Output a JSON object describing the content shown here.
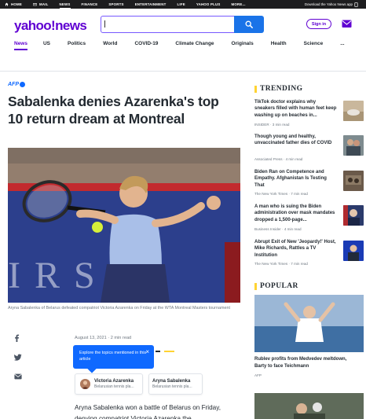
{
  "topbar": {
    "nav": [
      {
        "label": "HOME",
        "active": false
      },
      {
        "label": "MAIL",
        "active": false
      },
      {
        "label": "NEWS",
        "active": true
      },
      {
        "label": "FINANCE",
        "active": false
      },
      {
        "label": "SPORTS",
        "active": false
      },
      {
        "label": "ENTERTAINMENT",
        "active": false
      },
      {
        "label": "LIFE",
        "active": false
      },
      {
        "label": "YAHOO PLUS",
        "active": false
      },
      {
        "label": "MORE...",
        "active": false
      }
    ],
    "download_text": "Download the Yahoo News app"
  },
  "header": {
    "logo": "yahoo!news",
    "search": {
      "value": "",
      "placeholder": ""
    },
    "signin_label": "Sign in",
    "subnav": [
      {
        "label": "News",
        "active": true
      },
      {
        "label": "US",
        "active": false
      },
      {
        "label": "Politics",
        "active": false
      },
      {
        "label": "World",
        "active": false
      },
      {
        "label": "COVID-19",
        "active": false
      },
      {
        "label": "Climate Change",
        "active": false
      },
      {
        "label": "Originals",
        "active": false
      },
      {
        "label": "Health",
        "active": false
      },
      {
        "label": "Science",
        "active": false
      },
      {
        "label": "...",
        "active": false
      }
    ]
  },
  "article": {
    "source": "AFP",
    "headline": "Sabalenka denies Azarenka's top 10 return dream at Montreal",
    "caption": "Aryna Sabalenka of Belarus defeated compatriot Victoria Azarenka on Friday at the WTA Montreal Masters tournament",
    "date": "August 13, 2021",
    "read_time": "2 min read",
    "tooltip_text": "Explore the topics mentioned in this article",
    "tooltip_close": "×",
    "topics": [
      {
        "name": "Victoria Azarenka",
        "desc": "Belarusian tennis pla..."
      },
      {
        "name": "Aryna Sabalenka",
        "desc": "Belarusian tennis pla..."
      }
    ],
    "body_start": "Aryna Sabalenka won a battle of Belarus on Friday, denying compatriot Victoria Azarenka the"
  },
  "sidebar": {
    "trending_title": "TRENDING",
    "trending": [
      {
        "title": "TikTok doctor explains why sneakers filled with human feet keep washing up on beaches in...",
        "source": "INSIDER",
        "read_time": "3 min read"
      },
      {
        "title": "Though young and healthy, unvaccinated father dies of COVID",
        "source": "Associated Press",
        "read_time": "4 min read"
      },
      {
        "title": "Biden Ran on Competence and Empathy. Afghanistan Is Testing That",
        "source": "The New York Times",
        "read_time": "7 min read"
      },
      {
        "title": "A man who is suing the Biden administration over mask mandates dropped a 1,500-page...",
        "source": "Business Insider",
        "read_time": "4 min read"
      },
      {
        "title": "Abrupt Exit of New 'Jeopardy!' Host, Mike Richards, Rattles a TV Institution",
        "source": "The New York Times",
        "read_time": "7 min read"
      }
    ],
    "popular_title": "POPULAR",
    "popular": [
      {
        "title": "Rublev profits from Medvedev meltdown, Barty to face Teichmann",
        "source": "AFP"
      }
    ]
  },
  "colors": {
    "brand": "#6001d2",
    "accent_blue": "#0f69ff",
    "section_yellow": "#ffd333"
  }
}
